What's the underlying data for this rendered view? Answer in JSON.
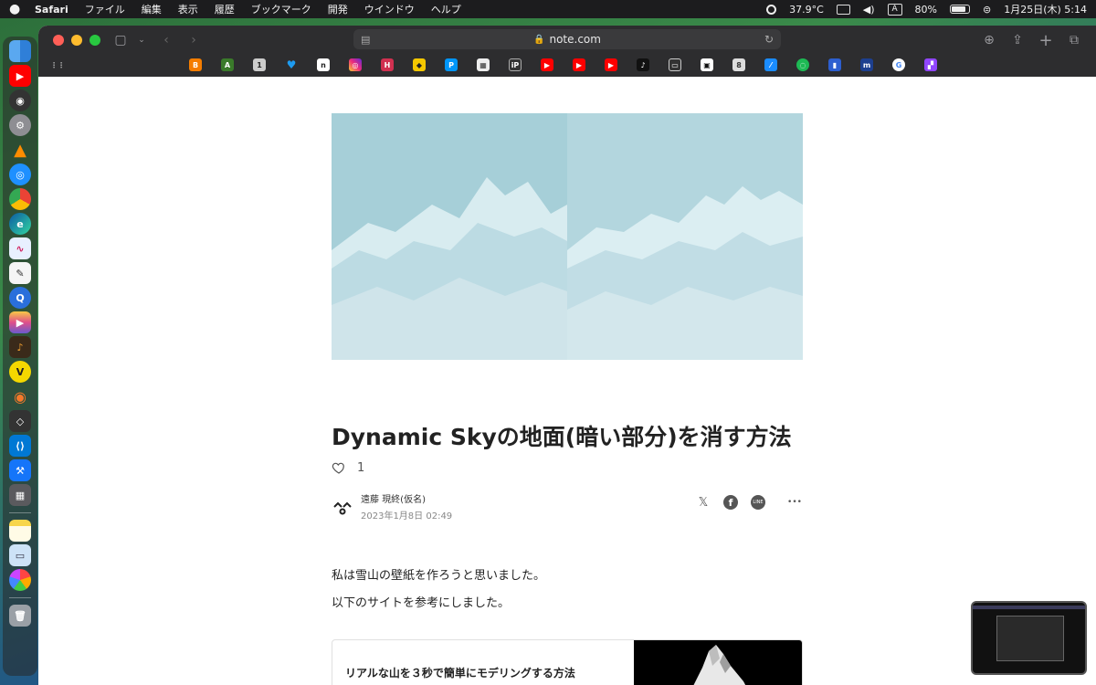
{
  "menubar": {
    "app": "Safari",
    "items": [
      "ファイル",
      "編集",
      "表示",
      "履歴",
      "ブックマーク",
      "開発",
      "ウインドウ",
      "ヘルプ"
    ],
    "temperature": "37.9°C",
    "input_mode": "A",
    "battery": "80%",
    "datetime": "1月25日(木) 5:14"
  },
  "browser": {
    "url": "note.com"
  },
  "article": {
    "title": "Dynamic Skyの地面(暗い部分)を消す方法",
    "likes": "1",
    "author": "遠藤 現終(仮名)",
    "date": "2023年1月8日 02:49",
    "paragraphs": [
      "私は雪山の壁紙を作ろうと思いました。",
      "以下のサイトを参考にしました。"
    ],
    "link_card_title": "リアルな山を３秒で簡単にモデリングする方法"
  },
  "share": {
    "x_icon": "𝕏",
    "facebook_icon": "f",
    "line_icon": "LINE",
    "more_icon": "•••"
  },
  "colors": {
    "menubar_bg": "#1c1c1e",
    "toolbar_bg": "#2d2d2f",
    "address_bg": "#3a3a3c",
    "page_bg": "#ffffff"
  }
}
